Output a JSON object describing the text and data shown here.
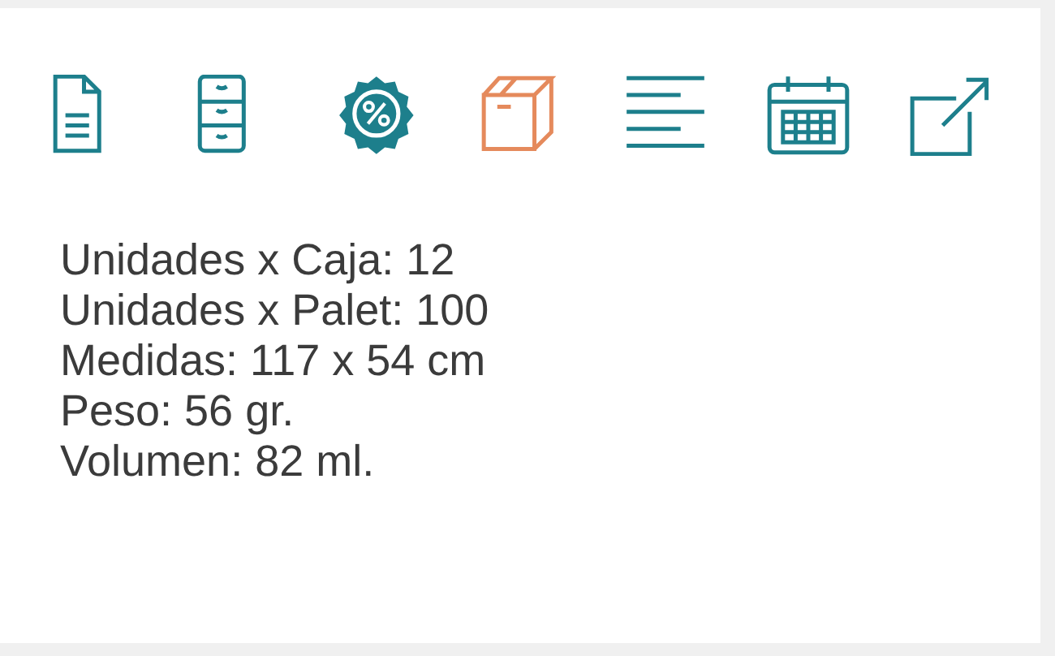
{
  "toolbar": [
    {
      "kind": "document",
      "selected": false
    },
    {
      "kind": "cabinet",
      "selected": false
    },
    {
      "kind": "discount",
      "selected": false
    },
    {
      "kind": "box",
      "selected": true
    },
    {
      "kind": "lines",
      "selected": false
    },
    {
      "kind": "calendar",
      "selected": false
    },
    {
      "kind": "external",
      "selected": false
    }
  ],
  "details": [
    "Unidades x Caja: 12",
    "Unidades x Palet: 100",
    "Medidas: 117 x 54 cm",
    "Peso: 56 gr.",
    "Volumen: 82 ml."
  ]
}
